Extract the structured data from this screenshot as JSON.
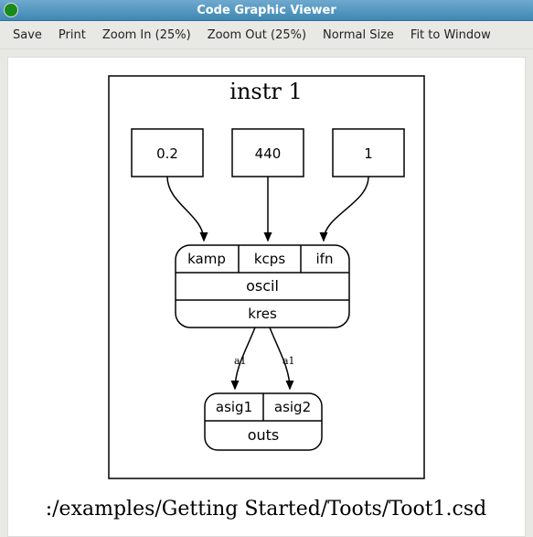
{
  "window": {
    "title": "Code Graphic Viewer"
  },
  "toolbar": {
    "save": "Save",
    "print": "Print",
    "zoom_in": "Zoom In (25%)",
    "zoom_out": "Zoom Out (25%)",
    "normal_size": "Normal Size",
    "fit_window": "Fit to Window"
  },
  "diagram": {
    "title": "instr 1",
    "inputs": [
      {
        "label": "0.2"
      },
      {
        "label": "440"
      },
      {
        "label": "1"
      }
    ],
    "oscil": {
      "ports_in": [
        "kamp",
        "kcps",
        "ifn"
      ],
      "op": "oscil",
      "port_out": "kres"
    },
    "edge_labels": [
      "a1",
      "a1"
    ],
    "outs": {
      "ports_in": [
        "asig1",
        "asig2"
      ],
      "op": "outs"
    },
    "file_path": ":/examples/Getting Started/Toots/Toot1.csd"
  }
}
